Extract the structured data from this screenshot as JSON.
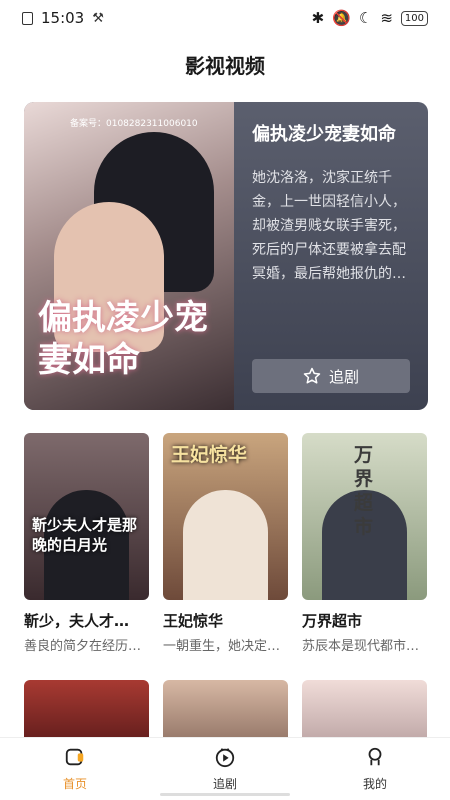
{
  "status": {
    "time": "15:03",
    "battery": "100"
  },
  "page": {
    "title": "影视视频"
  },
  "hero": {
    "filing": "备案号：0108282311006010",
    "poster_title": "偏执凌少宠妻如命",
    "title": "偏执凌少宠妻如命",
    "description": "她沈洛洛，沈家正统千金，上一世因轻信小人，却被渣男贱女联手害死，死后的尸体还要被拿去配冥婚，最后帮她报仇的…",
    "follow_label": "追剧"
  },
  "cards": [
    {
      "cover_text": "靳少夫人才是那晚的白月光",
      "title": "靳少，夫人才…",
      "desc": "善良的简夕在经历…",
      "color": "#5a3b3f"
    },
    {
      "cover_text": "王妃惊华",
      "title": "王妃惊华",
      "desc": "一朝重生，她决定…",
      "color": "#b48a6a"
    },
    {
      "cover_text": "万界超市",
      "title": "万界超市",
      "desc": "苏辰本是现代都市…",
      "color": "#a9b79a"
    }
  ],
  "row2": [
    {
      "color": "#8c2a2a"
    },
    {
      "color": "#c9a48f"
    },
    {
      "color": "#e7d0cf"
    }
  ],
  "tabs": [
    {
      "label": "首页",
      "icon": "home-icon"
    },
    {
      "label": "追剧",
      "icon": "play-icon"
    },
    {
      "label": "我的",
      "icon": "profile-icon"
    }
  ]
}
